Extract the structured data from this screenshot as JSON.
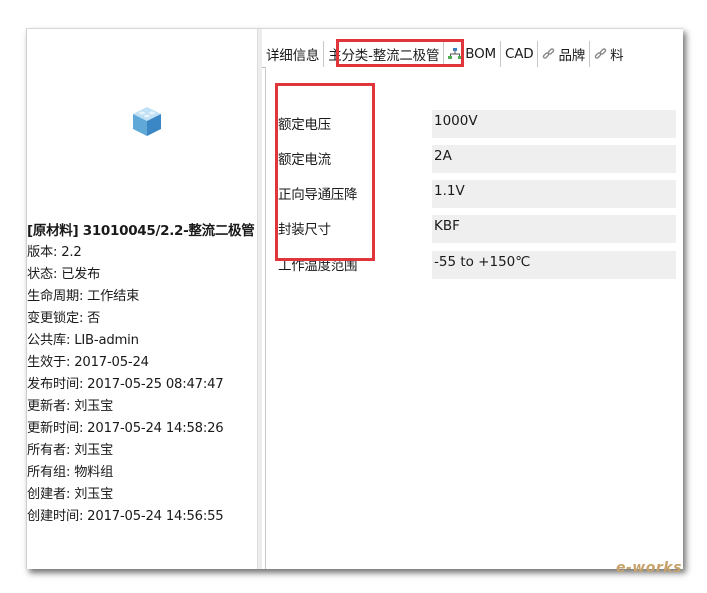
{
  "left_panel": {
    "title": "[原材料] 31010045/2.2-整流二极管",
    "properties": [
      "版本: 2.2",
      "状态: 已发布",
      "生命周期: 工作结束",
      "变更锁定: 否",
      "公共库: LIB-admin",
      "生效于: 2017-05-24",
      "发布时间: 2017-05-25 08:47:47",
      "更新者: 刘玉宝",
      "更新时间: 2017-05-24 14:58:26",
      "所有者: 刘玉宝",
      "所有组: 物料组",
      "创建者: 刘玉宝",
      "创建时间: 2017-05-24 14:56:55"
    ]
  },
  "tabs": [
    {
      "label": "详细信息",
      "icon": ""
    },
    {
      "label": "主分类-整流二极管",
      "icon": ""
    },
    {
      "label": "BOM",
      "icon": "bom-tree-icon"
    },
    {
      "label": "CAD",
      "icon": ""
    },
    {
      "label": "品牌",
      "icon": "link-icon"
    },
    {
      "label": "料",
      "icon": "link-icon"
    }
  ],
  "attributes": [
    {
      "label": "额定电压",
      "value": "1000V"
    },
    {
      "label": "额定电流",
      "value": "2A"
    },
    {
      "label": "正向导通压降",
      "value": "1.1V"
    },
    {
      "label": "封装尺寸",
      "value": "KBF"
    },
    {
      "label": "工作温度范围",
      "value": "-55 to +150℃"
    }
  ],
  "watermark": "e-works",
  "colors": {
    "highlight": "#e0353b",
    "value_bg": "#efefef"
  }
}
